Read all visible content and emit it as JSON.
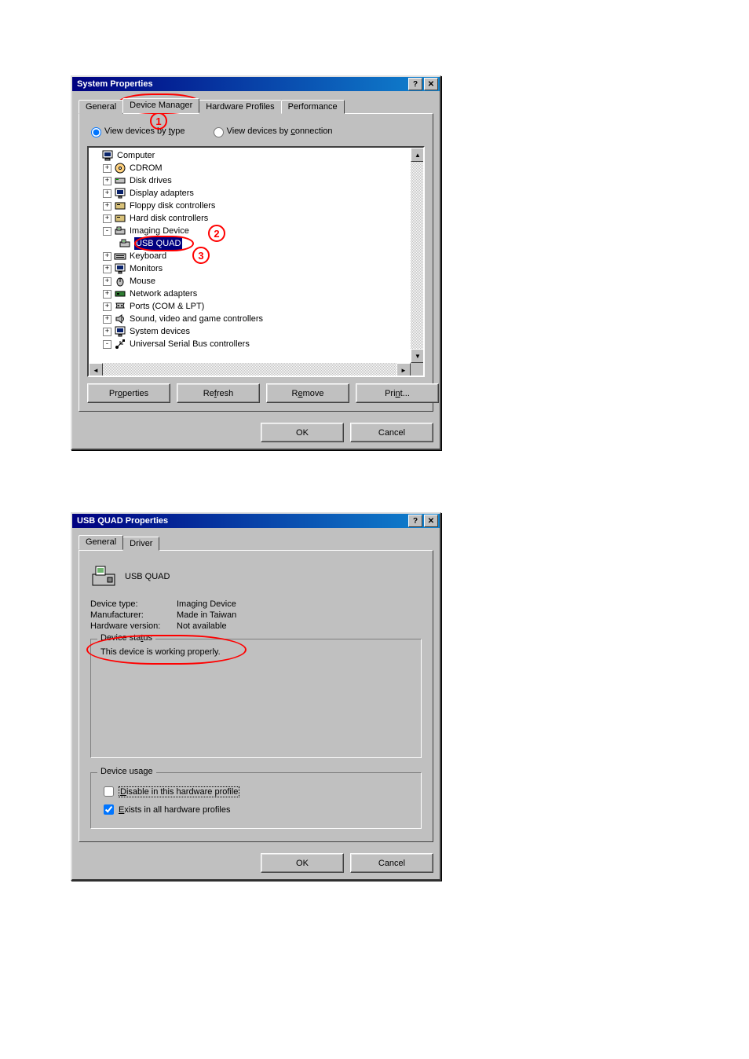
{
  "dialog1": {
    "title": "System Properties",
    "tabs": {
      "general": "General",
      "device_manager": "Device Manager",
      "hardware_profiles": "Hardware Profiles",
      "performance": "Performance"
    },
    "view_type_prefix": "View devices by ",
    "view_type_u": "t",
    "view_type_suffix": "ype",
    "view_conn_prefix": "View devices by ",
    "view_conn_u": "c",
    "view_conn_suffix": "onnection",
    "tree": {
      "computer": "Computer",
      "cdrom": "CDROM",
      "disk": "Disk drives",
      "display": "Display adapters",
      "floppy": "Floppy disk controllers",
      "hdd": "Hard disk controllers",
      "imaging": "Imaging Device",
      "usb_quad": "USB QUAD",
      "keyboard": "Keyboard",
      "monitors": "Monitors",
      "mouse": "Mouse",
      "network": "Network adapters",
      "ports": "Ports (COM & LPT)",
      "sound": "Sound, video and game controllers",
      "system": "System devices",
      "usb": "Universal Serial Bus controllers"
    },
    "buttons": {
      "properties_pre": "Pr",
      "properties_u": "o",
      "properties_post": "perties",
      "refresh_pre": "Re",
      "refresh_u": "f",
      "refresh_post": "resh",
      "remove_pre": "R",
      "remove_u": "e",
      "remove_post": "move",
      "print_pre": "Pri",
      "print_u": "n",
      "print_post": "t...",
      "ok": "OK",
      "cancel": "Cancel"
    },
    "annot": {
      "n1": "1",
      "n2": "2",
      "n3": "3"
    }
  },
  "dialog2": {
    "title": "USB QUAD Properties",
    "tabs": {
      "general": "General",
      "driver": "Driver"
    },
    "device_name": "USB QUAD",
    "rows": {
      "type_label": "Device type:",
      "type_value": "Imaging Device",
      "mfr_label": "Manufacturer:",
      "mfr_value": "Made in Taiwan",
      "hw_label": "Hardware version:",
      "hw_value": "Not available"
    },
    "status_legend_pre": "Device sta",
    "status_legend_u": "t",
    "status_legend_post": "us",
    "status_text": "This device is working properly.",
    "usage_legend": "Device usage",
    "cb_disable_u": "D",
    "cb_disable_post": "isable in this hardware profile",
    "cb_exists_u": "E",
    "cb_exists_post": "xists in all hardware profiles",
    "buttons": {
      "ok": "OK",
      "cancel": "Cancel"
    }
  }
}
